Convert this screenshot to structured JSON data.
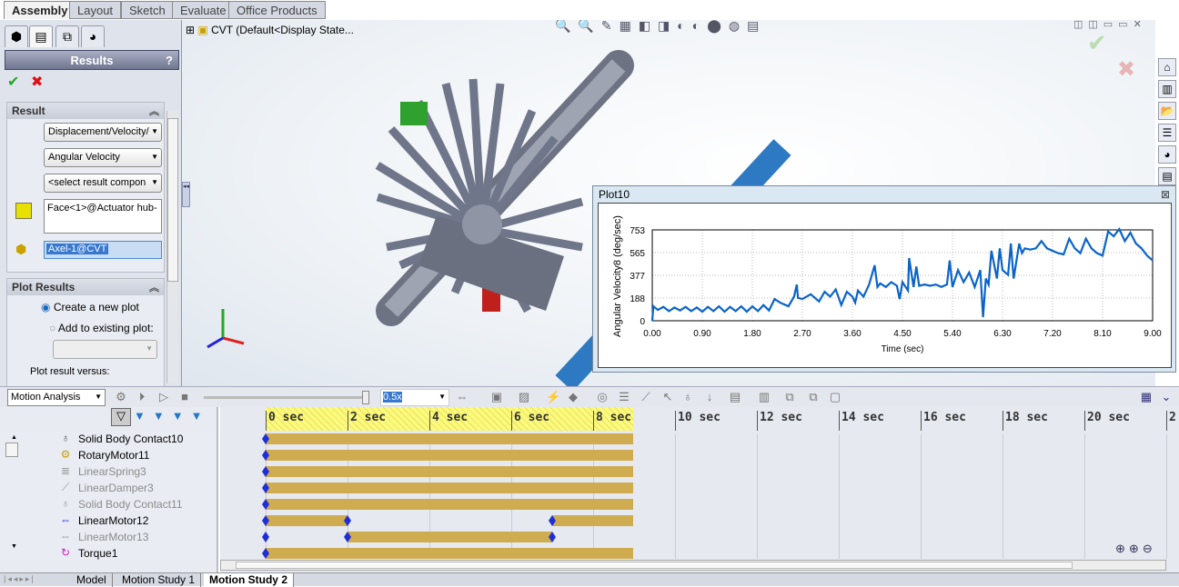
{
  "command_tabs": [
    "Assembly",
    "Layout",
    "Sketch",
    "Evaluate",
    "Office Products"
  ],
  "tree": {
    "root": "CVT  (Default<Display State..."
  },
  "panel": {
    "title": "Results",
    "help": "?",
    "ok": "✔",
    "cancel": "✖",
    "result_section": "Result",
    "category": "Displacement/Velocity/",
    "subcategory": "Angular Velocity",
    "component": "<select result compon",
    "face": "Face<1>@Actuator hub-",
    "reference": "Axel-1@CVT",
    "plot_section": "Plot Results",
    "radio_new": "Create a new plot",
    "radio_existing": "Add to existing plot:",
    "versus_label": "Plot result versus:"
  },
  "plot": {
    "window_title": "Plot10",
    "close": "⊠"
  },
  "chart_data": {
    "type": "line",
    "title": "",
    "xlabel": "Time (sec)",
    "ylabel": "Angular Velocity8 (deg/sec)",
    "xlim": [
      0,
      9
    ],
    "ylim": [
      0,
      753
    ],
    "x_ticks": [
      "0.00",
      "0.90",
      "1.80",
      "2.70",
      "3.60",
      "4.50",
      "5.40",
      "6.30",
      "7.20",
      "8.10",
      "9.00"
    ],
    "y_ticks": [
      "0",
      "188",
      "377",
      "565",
      "753"
    ],
    "grid": true,
    "color": "#0a64c8",
    "series": [
      {
        "x": [
          0,
          0.02,
          0.1,
          0.2,
          0.3,
          0.4,
          0.5,
          0.6,
          0.7,
          0.8,
          0.9,
          1.0,
          1.1,
          1.2,
          1.3,
          1.4,
          1.5,
          1.6,
          1.7,
          1.8,
          1.9,
          2.0,
          2.1,
          2.2,
          2.3,
          2.45,
          2.55,
          2.6,
          2.62,
          2.7,
          2.85,
          3.0,
          3.1,
          3.2,
          3.3,
          3.4,
          3.5,
          3.6,
          3.65,
          3.7,
          3.8,
          3.9,
          4.0,
          4.05,
          4.1,
          4.2,
          4.3,
          4.4,
          4.45,
          4.5,
          4.6,
          4.62,
          4.7,
          4.75,
          4.8,
          4.9,
          5.0,
          5.1,
          5.2,
          5.3,
          5.35,
          5.4,
          5.5,
          5.6,
          5.7,
          5.8,
          5.9,
          5.95,
          6.0,
          6.05,
          6.1,
          6.2,
          6.25,
          6.3,
          6.4,
          6.45,
          6.5,
          6.6,
          6.65,
          6.7,
          6.8,
          6.9,
          7.0,
          7.1,
          7.2,
          7.3,
          7.4,
          7.5,
          7.6,
          7.7,
          7.8,
          7.9,
          8.0,
          8.1,
          8.2,
          8.3,
          8.4,
          8.5,
          8.6,
          8.7,
          8.8,
          8.9,
          9.0
        ],
        "y": [
          0,
          120,
          90,
          115,
          80,
          110,
          85,
          115,
          80,
          110,
          75,
          115,
          80,
          120,
          75,
          115,
          80,
          120,
          75,
          120,
          80,
          130,
          85,
          180,
          150,
          120,
          200,
          300,
          190,
          180,
          220,
          160,
          240,
          200,
          260,
          130,
          240,
          200,
          150,
          250,
          200,
          300,
          460,
          280,
          310,
          280,
          320,
          290,
          180,
          320,
          250,
          520,
          280,
          450,
          290,
          300,
          290,
          300,
          280,
          300,
          500,
          280,
          420,
          320,
          400,
          280,
          420,
          30,
          350,
          300,
          580,
          350,
          600,
          420,
          380,
          640,
          350,
          640,
          560,
          600,
          590,
          600,
          660,
          600,
          580,
          560,
          550,
          680,
          600,
          560,
          680,
          600,
          560,
          540,
          740,
          700,
          760,
          660,
          730,
          640,
          600,
          540,
          500
        ]
      }
    ]
  },
  "motion": {
    "study_type": "Motion Analysis",
    "speed": "0.5x",
    "time_ticks": [
      "0 sec",
      "2 sec",
      "4 sec",
      "6 sec",
      "8 sec",
      "10 sec",
      "12 sec",
      "14 sec",
      "16 sec",
      "18 sec",
      "20 sec",
      "2"
    ],
    "rows": [
      {
        "label": "Solid Body Contact10",
        "icon": "contact-icon",
        "dim": false
      },
      {
        "label": "RotaryMotor11",
        "icon": "rotary-motor-icon",
        "dim": false
      },
      {
        "label": "LinearSpring3",
        "icon": "spring-icon",
        "dim": true
      },
      {
        "label": "LinearDamper3",
        "icon": "damper-icon",
        "dim": true
      },
      {
        "label": "Solid Body Contact11",
        "icon": "contact-icon",
        "dim": true
      },
      {
        "label": "LinearMotor12",
        "icon": "linear-motor-icon",
        "dim": false
      },
      {
        "label": "LinearMotor13",
        "icon": "linear-motor-icon",
        "dim": true
      },
      {
        "label": "Torque1",
        "icon": "torque-icon",
        "dim": false
      }
    ]
  },
  "bottom_tabs": [
    "Model",
    "Motion Study 1",
    "Motion Study 2"
  ]
}
